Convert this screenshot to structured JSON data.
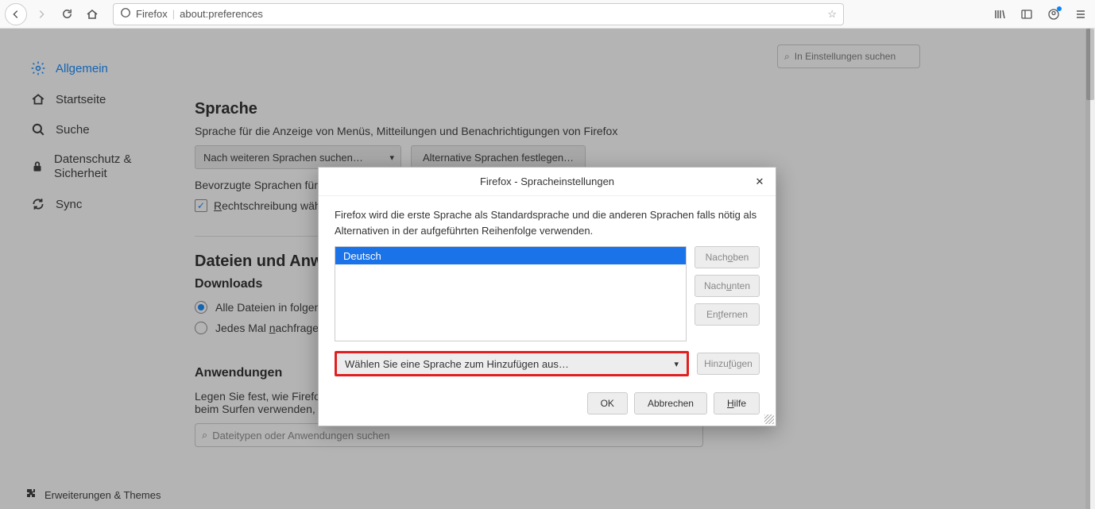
{
  "toolbar": {
    "identity": "Firefox",
    "url": "about:preferences"
  },
  "sidebar": {
    "items": [
      {
        "label": "Allgemein"
      },
      {
        "label": "Startseite"
      },
      {
        "label": "Suche"
      },
      {
        "label": "Datenschutz & Sicherheit"
      },
      {
        "label": "Sync"
      }
    ],
    "footer": "Erweiterungen & Themes"
  },
  "search": {
    "placeholder": "In Einstellungen suchen"
  },
  "language": {
    "heading": "Sprache",
    "desc": "Sprache für die Anzeige von Menüs, Mitteilungen und Benachrichtigungen von Firefox",
    "dropdown": "Nach weiteren Sprachen suchen…",
    "alt_btn": "Alternative Sprachen festlegen…",
    "preferred_prefix": "Bevorzugte Sprachen für di",
    "spellcheck_prefix": "R",
    "spellcheck_rest": "echtschreibung währ"
  },
  "files": {
    "heading": "Dateien und Anwen",
    "downloads_heading": "Downloads",
    "radio1": "Alle Dateien in folgend",
    "radio2_pre": "Jedes Mal ",
    "radio2_u": "n",
    "radio2_post": "achfragen,"
  },
  "apps": {
    "heading": "Anwendungen",
    "desc": "Legen Sie fest, wie Firefox mit Dateien verfährt, die Sie aus dem Web oder aus Anwendungen, die Sie beim Surfen verwenden, herunterladen.",
    "search_placeholder": "Dateitypen oder Anwendungen suchen"
  },
  "dialog": {
    "title": "Firefox - Spracheinstellungen",
    "desc": "Firefox wird die erste Sprache als Standardsprache und die anderen Sprachen falls nötig als Alternativen in der aufgeführten Reihenfolge verwenden.",
    "lang": "Deutsch",
    "btn_up_pre": "Nach ",
    "btn_up_u": "o",
    "btn_up_post": "ben",
    "btn_down_pre": "Nach ",
    "btn_down_u": "u",
    "btn_down_post": "nten",
    "btn_remove_pre": "En",
    "btn_remove_u": "t",
    "btn_remove_post": "fernen",
    "add_dd": "Wählen Sie eine Sprache zum Hinzufügen aus…",
    "btn_add_pre": "Hinzu",
    "btn_add_u": "f",
    "btn_add_post": "ügen",
    "ok": "OK",
    "cancel": "Abbrechen",
    "help_u": "H",
    "help_post": "ilfe"
  }
}
